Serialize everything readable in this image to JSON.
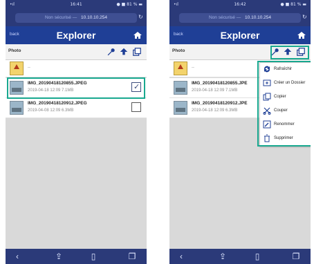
{
  "screens": [
    {
      "status": {
        "signal": "•ıl",
        "time": "16:41",
        "battery": "● ■ 81 % ▬"
      },
      "url": {
        "hint": "Non sécurisé —",
        "address": "10.10.10.254"
      },
      "nav": {
        "back": "back",
        "title": "Explorer"
      },
      "path": "Photo",
      "parent": {
        "label": ".."
      },
      "files": [
        {
          "name": "IMG_20190418120855.JPEG",
          "meta": "2019-04-18 12:09 7.1MB",
          "checked": true
        },
        {
          "name": "IMG_20190418120912.JPEG",
          "meta": "2019-04-08 12:09 6.3MB",
          "checked": false
        }
      ]
    },
    {
      "status": {
        "signal": "•ıl",
        "time": "16:42",
        "battery": "● ■ 81 % ▬"
      },
      "url": {
        "hint": "Non sécurisé —",
        "address": "10.10.10.254"
      },
      "nav": {
        "back": "back",
        "title": "Explorer"
      },
      "path": "Photo",
      "parent": {
        "label": ".."
      },
      "files": [
        {
          "name": "IMG_20190418120855.JPE",
          "meta": "2019-04-18 12:09 7.1MB"
        },
        {
          "name": "IMG_20190418120912.JPE",
          "meta": "2019-04-18 12:09 6.3MB"
        }
      ],
      "menu": [
        {
          "label": "Rafraîchir",
          "icon": "refresh-icon"
        },
        {
          "label": "Créer un Dossier",
          "icon": "new-folder-icon"
        },
        {
          "label": "Copier",
          "icon": "copy-icon"
        },
        {
          "label": "Couper",
          "icon": "scissors-icon"
        },
        {
          "label": "Renommer",
          "icon": "rename-icon"
        },
        {
          "label": "Supprimer",
          "icon": "trash-icon"
        }
      ]
    }
  ],
  "colors": {
    "bar": "#2b3a79",
    "nav": "#1f3f96",
    "highlight": "#18a88f"
  },
  "bottom_icons": [
    "back-chevron-icon",
    "share-icon",
    "bookmarks-icon",
    "tabs-icon"
  ]
}
